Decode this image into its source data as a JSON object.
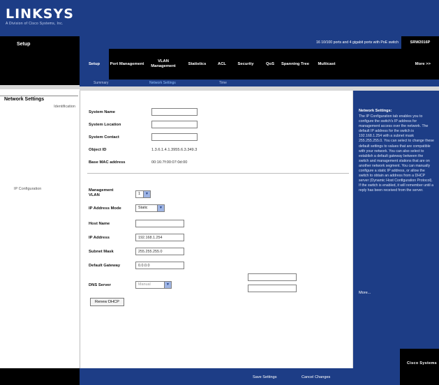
{
  "brand": {
    "name": "LINKSYS",
    "tagline": "A Division of Cisco Systems, Inc."
  },
  "header": {
    "setup_label": "Setup",
    "product_line": "16 10/100 ports and 4 gigabit ports with PoE switch",
    "model": "SRW2016P"
  },
  "tabs": [
    {
      "label": "Setup",
      "active": true
    },
    {
      "label": "Port Management"
    },
    {
      "label": "VLAN Management"
    },
    {
      "label": "Statistics"
    },
    {
      "label": "ACL"
    },
    {
      "label": "Security"
    },
    {
      "label": "QoS"
    },
    {
      "label": "Spanning Tree"
    },
    {
      "label": "Multicast"
    },
    {
      "label": "More >>"
    }
  ],
  "subnav": {
    "summary": "Summary",
    "network": "Network Settings",
    "time": "Time"
  },
  "left": {
    "title": "Network Settings",
    "identification": "Identification",
    "ip_config": "IP Configuration"
  },
  "identification": {
    "system_name_label": "System Name",
    "system_location_label": "System Location",
    "system_contact_label": "System Contact",
    "object_id_label": "Object ID",
    "object_id_value": "1.3.6.1.4.1.3955.6.3.349.3",
    "mac_label": "Base MAC address",
    "mac_value": "00:16:7f:00:07:0d:00"
  },
  "ip": {
    "mgmt_vlan_label": "Management VLAN",
    "mgmt_vlan_value": "1",
    "ip_mode_label": "IP Address Mode",
    "ip_mode_value": "Static",
    "host_label": "Host Name",
    "ip_label": "IP Address",
    "ip_value": "192.168.1.254",
    "mask_label": "Subnet Mask",
    "mask_value": "255.255.255.0",
    "gateway_label": "Default Gateway",
    "gateway_value": "0.0.0.0",
    "dns_label": "DNS Server",
    "dns_value": "Manual",
    "renew_button": "Renew DHCP"
  },
  "help": {
    "title": "Network Settings:",
    "text": "The IP Configuration tab enables you to configure the switch's IP address for management access over the network. The default IP address for the switch is 192.168.1.254 with a subnet mask 255.255.255.0. You can select to change these default settings to values that are compatible with your network. You can also select to establish a default gateway between the switch and management stations that are on another network segment. You can manually configure a static IP address, or allow the switch to obtain an address from a DHCP server (Dynamic Host Configuration Protocol). If the switch is enabled, it will remember until a reply has been received from the server.",
    "more": "More..."
  },
  "footer": {
    "save": "Save Settings",
    "cancel": "Cancel Changes",
    "cisco": "Cisco Systems"
  }
}
